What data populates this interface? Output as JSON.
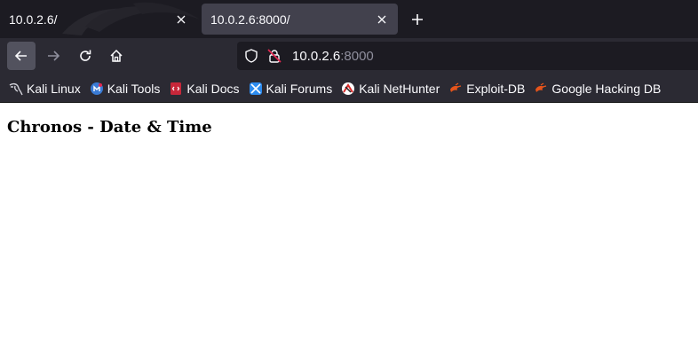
{
  "tabs": [
    {
      "label": "10.0.2.6/",
      "active": false
    },
    {
      "label": "10.0.2.6:8000/",
      "active": true
    }
  ],
  "address_bar": {
    "host": "10.0.2.6",
    "port": ":8000"
  },
  "bookmarks": [
    {
      "label": "Kali Linux",
      "icon": "kali-dragon-icon"
    },
    {
      "label": "Kali Tools",
      "icon": "kali-tools-icon"
    },
    {
      "label": "Kali Docs",
      "icon": "kali-docs-icon"
    },
    {
      "label": "Kali Forums",
      "icon": "kali-forums-icon"
    },
    {
      "label": "Kali NetHunter",
      "icon": "kali-nethunter-icon"
    },
    {
      "label": "Exploit-DB",
      "icon": "exploit-db-icon"
    },
    {
      "label": "Google Hacking DB",
      "icon": "ghdb-icon"
    }
  ],
  "page": {
    "heading": "Chronos - Date & Time"
  },
  "colors": {
    "tabstrip_bg": "#1c1b22",
    "toolbar_bg": "#2b2a33",
    "active_tab_bg": "#42414d",
    "text_light": "#fbfbfe",
    "port_grey": "#8f8f9d",
    "insecure_red": "#e22850",
    "exploit_orange": "#e5541b"
  }
}
